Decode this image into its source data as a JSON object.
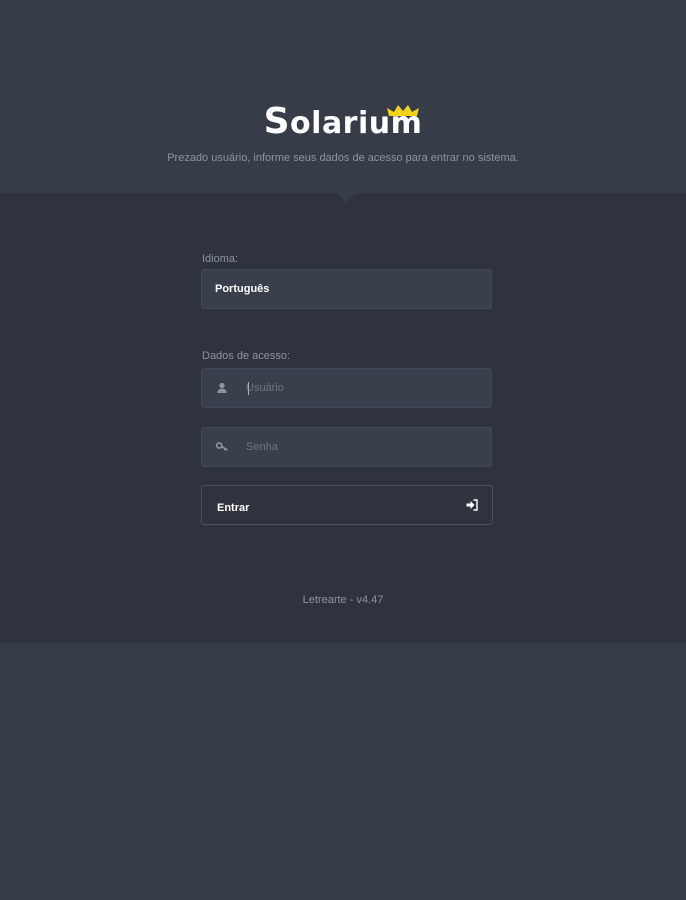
{
  "app": {
    "logo_text": "Solarium",
    "logo_first_letter": "S",
    "logo_rest": "olarium",
    "subtitle": "Prezado usuário, informe seus dados de acesso para entrar no sistema.",
    "accent_color": "#f2d21b"
  },
  "form": {
    "language_label": "Idioma:",
    "language_value": "Português",
    "access_label": "Dados de acesso:",
    "username": {
      "placeholder": "Usuário",
      "value": "",
      "icon": "user-icon"
    },
    "password": {
      "placeholder": "Senha",
      "value": "",
      "icon": "key-icon"
    },
    "submit_label": "Entrar",
    "submit_icon": "sign-in-icon"
  },
  "footer": {
    "text": "Letrearte - v4.47"
  }
}
